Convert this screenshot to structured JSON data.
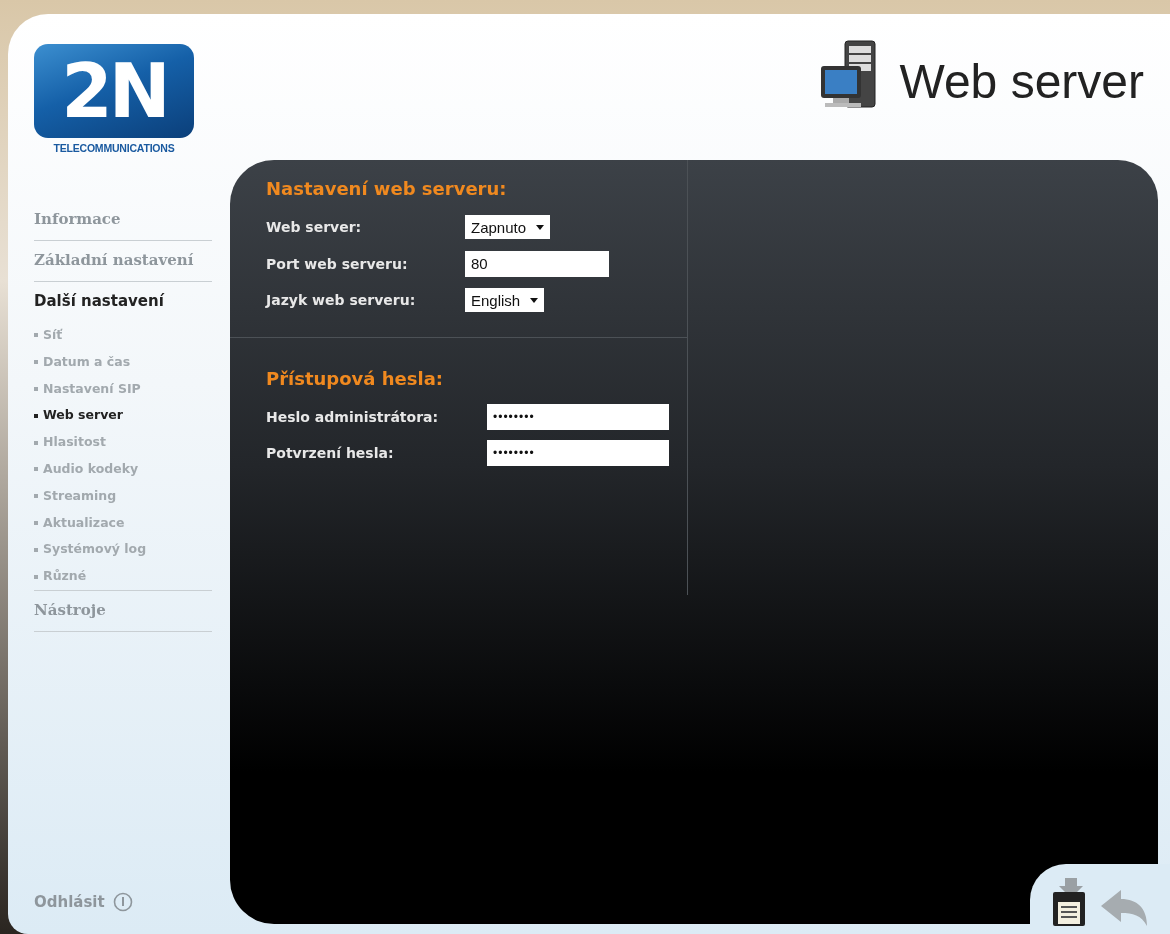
{
  "logo": {
    "mark": "2N",
    "tagline": "TELECOMMUNICATIONS"
  },
  "page_title": "Web server",
  "nav": [
    {
      "label": "Informace",
      "kind": "section",
      "selected": false
    },
    {
      "label": "Základní nastavení",
      "kind": "section",
      "selected": false
    },
    {
      "label": "Další nastavení",
      "kind": "section",
      "selected": true
    },
    {
      "label": "Síť",
      "kind": "sub",
      "selected": false
    },
    {
      "label": "Datum a čas",
      "kind": "sub",
      "selected": false
    },
    {
      "label": "Nastavení SIP",
      "kind": "sub",
      "selected": false
    },
    {
      "label": "Web server",
      "kind": "sub",
      "selected": true
    },
    {
      "label": "Hlasitost",
      "kind": "sub",
      "selected": false
    },
    {
      "label": "Audio kodeky",
      "kind": "sub",
      "selected": false
    },
    {
      "label": "Streaming",
      "kind": "sub",
      "selected": false
    },
    {
      "label": "Aktualizace",
      "kind": "sub",
      "selected": false
    },
    {
      "label": "Systémový log",
      "kind": "sub",
      "selected": false
    },
    {
      "label": "Různé",
      "kind": "sub",
      "selected": false
    },
    {
      "label": "Nástroje",
      "kind": "section",
      "selected": false
    }
  ],
  "logout": "Odhlásit",
  "sections": [
    {
      "title": "Nastavení web serveru:",
      "fields": [
        {
          "label": "Web server:",
          "kind": "select",
          "value": "Zapnuto"
        },
        {
          "label": "Port web serveru:",
          "kind": "text",
          "value": "80"
        },
        {
          "label": "Jazyk web serveru:",
          "kind": "select",
          "value": "English"
        }
      ]
    },
    {
      "title": "Přístupová hesla:",
      "fields": [
        {
          "label": "Heslo administrátora:",
          "kind": "password",
          "value": "••••••••"
        },
        {
          "label": "Potvrzení hesla:",
          "kind": "password",
          "value": "••••••••"
        }
      ]
    }
  ]
}
